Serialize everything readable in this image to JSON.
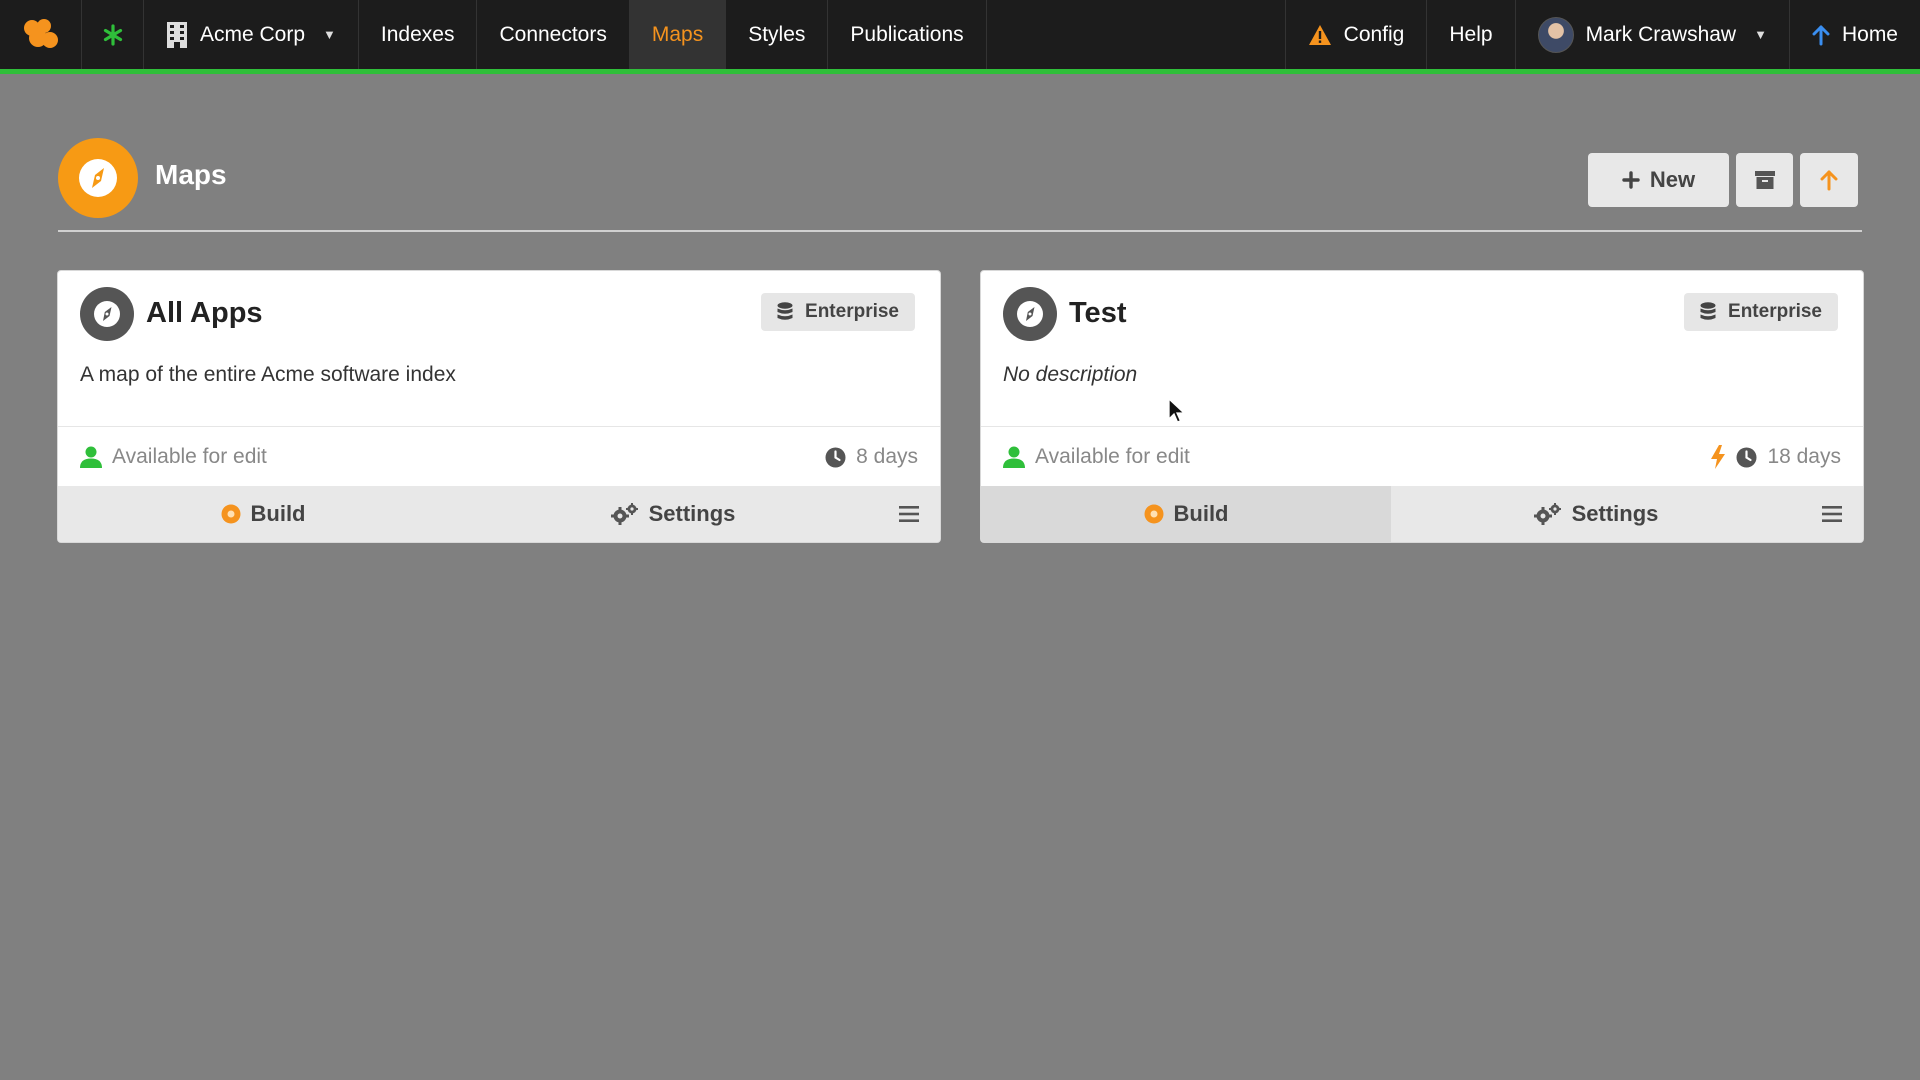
{
  "nav": {
    "org": "Acme Corp",
    "items": [
      {
        "label": "Indexes"
      },
      {
        "label": "Connectors"
      },
      {
        "label": "Maps"
      },
      {
        "label": "Styles"
      },
      {
        "label": "Publications"
      }
    ],
    "config": "Config",
    "help": "Help",
    "user": "Mark Crawshaw",
    "home": "Home",
    "colors": {
      "bar": "#1c1c1c",
      "accent": "#2fbf3a",
      "active": "#f5931e"
    }
  },
  "page": {
    "title": "Maps",
    "new_label": "New",
    "icon": "compass-icon"
  },
  "cards": [
    {
      "title": "All Apps",
      "badge": "Enterprise",
      "description": "A map of the entire Acme software index",
      "status": "Available for edit",
      "age": "8 days",
      "build": "Build",
      "settings": "Settings"
    },
    {
      "title": "Test",
      "badge": "Enterprise",
      "description": "No description",
      "status": "Available for edit",
      "age": "18 days",
      "build": "Build",
      "settings": "Settings"
    }
  ]
}
